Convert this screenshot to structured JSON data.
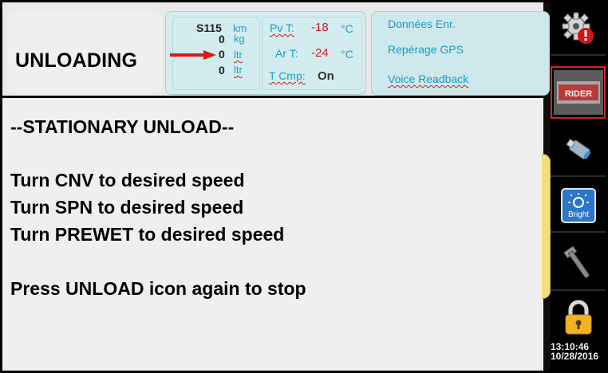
{
  "header": {
    "title": "UNLOADING"
  },
  "readings": {
    "distance_value": "S115",
    "distance_unit": "km",
    "weight_value": "0",
    "weight_unit": "kg",
    "volume1_value": "0",
    "volume1_unit": "ltr",
    "volume2_value": "0",
    "volume2_unit": "ltr"
  },
  "temperatures": {
    "pavement_label": "Pv T:",
    "pavement_value": "-18",
    "pavement_unit": "°C",
    "air_label": "Ar T:",
    "air_value": "-24",
    "air_unit": "°C",
    "compensation_label": "T Cmp:",
    "compensation_value": "On"
  },
  "data_panel": {
    "items": [
      {
        "label": "Données Enr."
      },
      {
        "label": "Repérage GPS"
      },
      {
        "label": "Voice Readback"
      }
    ]
  },
  "main": {
    "lines": [
      "--STATIONARY UNLOAD--",
      "Turn CNV to desired speed",
      "Turn SPN to desired speed",
      "Turn PREWET to desired speed",
      "Press UNLOAD icon again to stop"
    ]
  },
  "sidebar": {
    "buttons": [
      {
        "icon": "gear-warning-icon"
      },
      {
        "icon": "spreader-icon",
        "label": "RIDER"
      },
      {
        "icon": "usb-stick-icon"
      },
      {
        "icon": "brightness-icon",
        "label": "Bright"
      },
      {
        "icon": "wrench-icon"
      },
      {
        "icon": "lock-icon"
      }
    ]
  },
  "status": {
    "time": "13:10:46",
    "date": "10/28/2016"
  },
  "colors": {
    "accent_blue": "#1aa0c9",
    "warning_red": "#e2131b",
    "tab_yellow": "#f3df7a"
  }
}
